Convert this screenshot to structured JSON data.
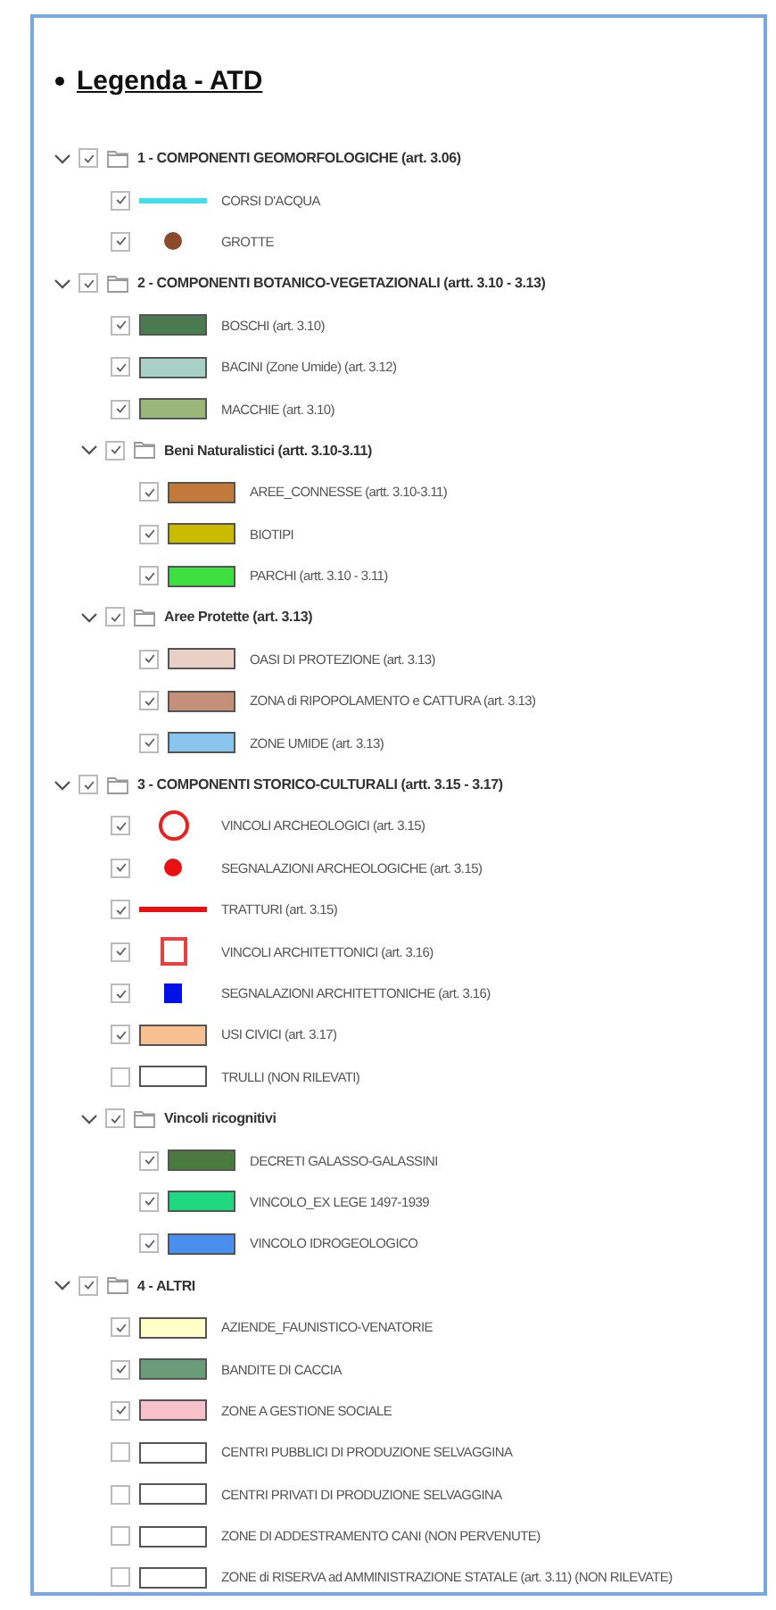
{
  "title": "Legenda - ATD",
  "groups": [
    {
      "kind": "group",
      "label": "1 - COMPONENTI GEOMORFOLOGICHE (art. 3.06)",
      "checked": true,
      "expanded": true,
      "children": [
        {
          "kind": "line",
          "label": "CORSI D'ACQUA",
          "checked": true,
          "color": "#40e0e8"
        },
        {
          "kind": "dot",
          "label": "GROTTE",
          "checked": true,
          "color": "#8b4a2b"
        }
      ]
    },
    {
      "kind": "group",
      "label": "2 - COMPONENTI BOTANICO-VEGETAZIONALI (artt. 3.10 - 3.13)",
      "checked": true,
      "expanded": true,
      "children": [
        {
          "kind": "fill",
          "label": "BOSCHI (art. 3.10)",
          "checked": true,
          "color": "#4a7a50"
        },
        {
          "kind": "fill",
          "label": "BACINI (Zone Umide) (art. 3.12)",
          "checked": true,
          "color": "#a8d0c4"
        },
        {
          "kind": "fill",
          "label": "MACCHIE (art. 3.10)",
          "checked": true,
          "color": "#9ab67a"
        },
        {
          "kind": "group",
          "label": "Beni Naturalistici (artt. 3.10-3.11)",
          "checked": true,
          "expanded": true,
          "children": [
            {
              "kind": "fill",
              "label": "AREE_CONNESSE (artt. 3.10-3.11)",
              "checked": true,
              "color": "#c27a3a"
            },
            {
              "kind": "fill",
              "label": "BIOTIPI",
              "checked": true,
              "color": "#c8bb00"
            },
            {
              "kind": "fill",
              "label": "PARCHI (artt. 3.10 - 3.11)",
              "checked": true,
              "color": "#3ee040"
            }
          ]
        },
        {
          "kind": "group",
          "label": "Aree Protette (art. 3.13)",
          "checked": true,
          "expanded": true,
          "children": [
            {
              "kind": "fill",
              "label": "OASI DI PROTEZIONE (art. 3.13)",
              "checked": true,
              "color": "#e8d0c4"
            },
            {
              "kind": "fill",
              "label": "ZONA di RIPOPOLAMENTO e CATTURA (art. 3.13)",
              "checked": true,
              "color": "#c4907a"
            },
            {
              "kind": "fill",
              "label": "ZONE UMIDE (art. 3.13)",
              "checked": true,
              "color": "#88c4ee"
            }
          ]
        }
      ]
    },
    {
      "kind": "group",
      "label": "3 - COMPONENTI STORICO-CULTURALI (artt. 3.15 - 3.17)",
      "checked": true,
      "expanded": true,
      "children": [
        {
          "kind": "ring",
          "label": "VINCOLI ARCHEOLOGICI (art. 3.15)",
          "checked": true,
          "color": "#e82020"
        },
        {
          "kind": "dot",
          "label": "SEGNALAZIONI ARCHEOLOGICHE (art. 3.15)",
          "checked": true,
          "color": "#e81010"
        },
        {
          "kind": "line",
          "label": "TRATTURI (art. 3.15)",
          "checked": true,
          "color": "#e81010"
        },
        {
          "kind": "frame",
          "label": "VINCOLI ARCHITETTONICI (art. 3.16)",
          "checked": true,
          "color": "#e84040"
        },
        {
          "kind": "square",
          "label": "SEGNALAZIONI ARCHITETTONICHE (art. 3.16)",
          "checked": true,
          "color": "#0010e8"
        },
        {
          "kind": "fill",
          "label": "USI CIVICI (art. 3.17)",
          "checked": true,
          "color": "#f8c090"
        },
        {
          "kind": "fill",
          "label": "TRULLI (NON RILEVATI)",
          "checked": false,
          "color": "#ffffff"
        },
        {
          "kind": "group",
          "label": "Vincoli ricognitivi",
          "checked": true,
          "expanded": true,
          "children": [
            {
              "kind": "fill",
              "label": "DECRETI GALASSO-GALASSINI",
              "checked": true,
              "color": "#4a7a40"
            },
            {
              "kind": "fill",
              "label": "VINCOLO_EX LEGE 1497-1939",
              "checked": true,
              "color": "#20d880"
            },
            {
              "kind": "fill",
              "label": "VINCOLO IDROGEOLOGICO",
              "checked": true,
              "color": "#4a8ef0"
            }
          ]
        }
      ]
    },
    {
      "kind": "group",
      "label": "4 - ALTRI",
      "checked": true,
      "expanded": true,
      "children": [
        {
          "kind": "fill",
          "label": "AZIENDE_FAUNISTICO-VENATORIE",
          "checked": true,
          "color": "#ffffc8"
        },
        {
          "kind": "fill",
          "label": "BANDITE DI CACCIA",
          "checked": true,
          "color": "#6a9c7a"
        },
        {
          "kind": "fill",
          "label": "ZONE A GESTIONE SOCIALE",
          "checked": true,
          "color": "#f8c0c8"
        },
        {
          "kind": "fill",
          "label": "CENTRI PUBBLICI DI PRODUZIONE SELVAGGINA",
          "checked": false,
          "color": "#ffffff"
        },
        {
          "kind": "fill",
          "label": "CENTRI PRIVATI DI PRODUZIONE SELVAGGINA",
          "checked": false,
          "color": "#ffffff"
        },
        {
          "kind": "fill",
          "label": "ZONE DI ADDESTRAMENTO CANI (NON PERVENUTE)",
          "checked": false,
          "color": "#ffffff"
        },
        {
          "kind": "fill",
          "label": "ZONE di RISERVA ad AMMINISTRAZIONE STATALE (art. 3.11) (NON RILEVATE)",
          "checked": false,
          "color": "#ffffff"
        }
      ]
    }
  ]
}
